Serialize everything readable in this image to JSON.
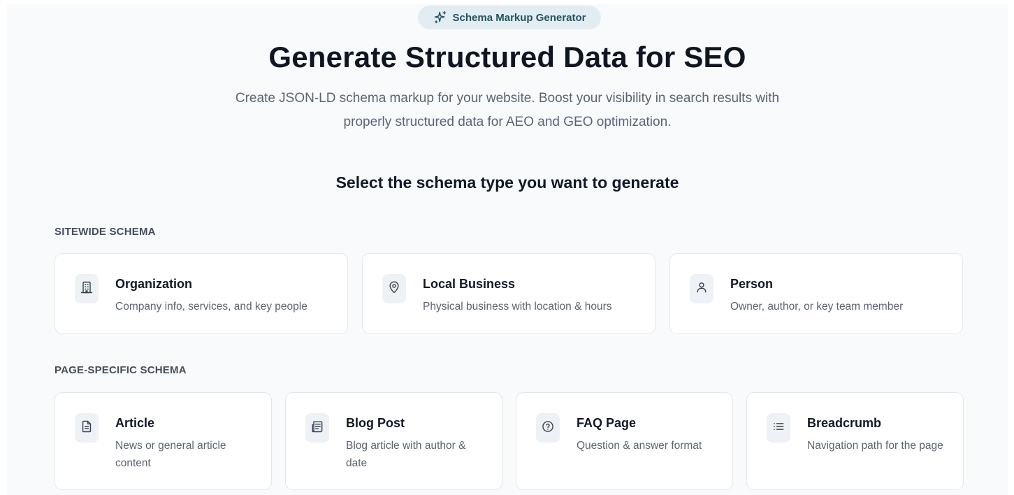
{
  "badge": {
    "icon": "sparkles-icon",
    "label": "Schema Markup Generator"
  },
  "hero": {
    "title": "Generate Structured Data for SEO",
    "subtitle": "Create JSON-LD schema markup for your website. Boost your visibility in search results with properly structured data for AEO and GEO optimization."
  },
  "select_heading": "Select the schema type you want to generate",
  "sections": {
    "sitewide": {
      "label": "SITEWIDE SCHEMA",
      "cards": [
        {
          "icon": "building-icon",
          "title": "Organization",
          "description": "Company info, services, and key people"
        },
        {
          "icon": "map-pin-icon",
          "title": "Local Business",
          "description": "Physical business with location & hours"
        },
        {
          "icon": "user-icon",
          "title": "Person",
          "description": "Owner, author, or key team member"
        }
      ]
    },
    "page_specific": {
      "label": "PAGE-SPECIFIC SCHEMA",
      "cards": [
        {
          "icon": "file-text-icon",
          "title": "Article",
          "description": "News or general article content"
        },
        {
          "icon": "newspaper-icon",
          "title": "Blog Post",
          "description": "Blog article with author & date"
        },
        {
          "icon": "help-circle-icon",
          "title": "FAQ Page",
          "description": "Question & answer format"
        },
        {
          "icon": "list-icon",
          "title": "Breadcrumb",
          "description": "Navigation path for the page"
        }
      ]
    }
  },
  "colors": {
    "page_background": "#f8fafc",
    "badge_background": "#e2edf2",
    "badge_text": "#24535f",
    "icon_box": "#eef1f5",
    "muted_text": "#5b6474"
  }
}
